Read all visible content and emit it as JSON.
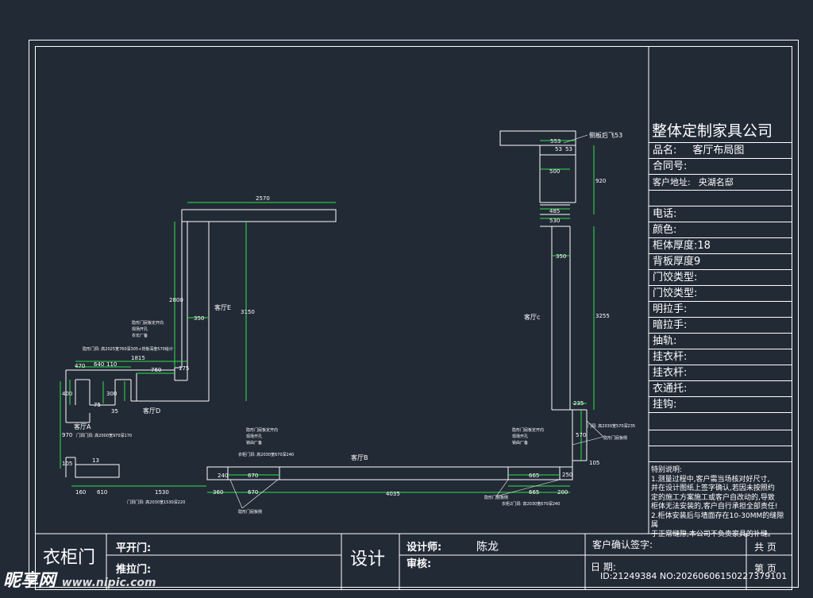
{
  "title_block": {
    "company": "整体定制家具公司",
    "rows": [
      {
        "label": "品名:",
        "value": "客厅布局图"
      },
      {
        "label": "合同号:",
        "value": ""
      },
      {
        "label": "客户地址:",
        "value": "央湖名邸"
      },
      {
        "label": "",
        "value": ""
      },
      {
        "label": "电话:",
        "value": ""
      },
      {
        "label": "颜色:",
        "value": ""
      },
      {
        "label": "柜体厚度:18",
        "value": ""
      },
      {
        "label": "背板厚度9",
        "value": ""
      },
      {
        "label": "门饺类型:",
        "value": ""
      },
      {
        "label": "门饺类型:",
        "value": ""
      },
      {
        "label": "明拉手:",
        "value": ""
      },
      {
        "label": "暗拉手:",
        "value": ""
      },
      {
        "label": "抽轨:",
        "value": ""
      },
      {
        "label": "挂衣杆:",
        "value": ""
      },
      {
        "label": "挂衣杆:",
        "value": ""
      },
      {
        "label": "衣通托:",
        "value": ""
      },
      {
        "label": "挂钩:",
        "value": ""
      }
    ],
    "notes_title": "特别说明:",
    "notes": [
      "1.测量过程中,客户需当场核对好尺寸,",
      "并在设计图纸上签字确认,若因未按照约",
      "定的施工方案施工或客户自改动的,导致",
      "柜体无法安装的,客户自行承担全部责任!",
      "2.柜体安装后与墙面存在10-30MM的缝隙属",
      "于正常缝隙,本公司不负责家具的补缝。"
    ]
  },
  "bottom": {
    "left_big": "衣柜门",
    "swing_door": "平开门:",
    "slide_door": "推拉门:",
    "design_big": "设计",
    "designer_label": "设计师:",
    "designer_name": "陈龙",
    "review_label": "审核:",
    "client_sign": "客户确认签字:",
    "date_label": "日 期:",
    "total_pages": "共 页",
    "page_no": "第 页"
  },
  "drawing": {
    "side_panel_label": "侧板后飞53",
    "rooms": {
      "a": "客厅A",
      "b": "客厅B",
      "c": "客厅c",
      "d": "客厅D",
      "e": "客厅E"
    },
    "dims_top": [
      "2570",
      "553",
      "53",
      "53",
      "500",
      "920",
      "485",
      "530"
    ],
    "dims_left": [
      "2800",
      "350",
      "3150",
      "1815",
      "640",
      "760",
      "110",
      "175",
      "470",
      "300",
      "400",
      "75",
      "35",
      "970",
      "105",
      "13"
    ],
    "dims_right": [
      "350",
      "3255",
      "235",
      "570",
      "105",
      "250"
    ],
    "dims_bottom": [
      "160",
      "610",
      "1530",
      "360",
      "670",
      "670",
      "4035",
      "665",
      "665",
      "240",
      "200"
    ],
    "notes": {
      "n1": "隐形门屁板定开向",
      "n2": "现场开孔",
      "n3": "衣长厂备",
      "n4": "隐形门洞: 高2025宽760深305+背板深度570给计",
      "n5": "门洞门洞: 高2000宽970深170",
      "n6": "门洞门洞: 高2030宽1530深220",
      "n7": "隐形门屁板定开向",
      "n8": "现场开孔",
      "n9": "锁由厂备",
      "n10": "衣柜门洞: 高2030宽670深240",
      "n11": "隐形门屁板定开向",
      "n12": "现场开孔",
      "n13": "锁由厂备",
      "n14": "衣柜2门洞: 高2030宽670深240",
      "n15": "门洞: 高2030宽570深235",
      "n16": "隐形门屁板侧",
      "n17": "隐形门屁板侧",
      "n18": "隐形门屁板侧"
    }
  },
  "watermark": {
    "logo": "昵享网",
    "url": "www.nipic.com"
  },
  "id_tag": "ID:21249384 NO:20260606150227379101"
}
